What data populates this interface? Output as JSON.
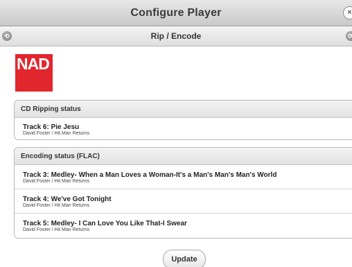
{
  "window": {
    "title": "Configure Player",
    "close_icon": "×"
  },
  "nav": {
    "subtitle": "Rip / Encode",
    "back_icon": "⟲",
    "forward_icon": "⟳"
  },
  "logo": {
    "text": "NAD",
    "color": "#e1262d"
  },
  "cd_ripping": {
    "header": "CD Ripping status",
    "tracks": [
      {
        "title": "Track 6: Pie Jesu",
        "subtitle": "David Foster / Hit Man Returns"
      }
    ]
  },
  "encoding": {
    "header": "Encoding status (FLAC)",
    "tracks": [
      {
        "title": "Track 3: Medley- When a Man Loves a Woman-It's a Man's Man's Man's World",
        "subtitle": "David Foster / Hit Man Returns"
      },
      {
        "title": "Track 4: We've Got Tonight",
        "subtitle": "David Foster / Hit Man Returns"
      },
      {
        "title": "Track 5: Medley- I Can Love You Like That-I Swear",
        "subtitle": "David Foster / Hit Man Returns"
      }
    ]
  },
  "update_label": "Update"
}
